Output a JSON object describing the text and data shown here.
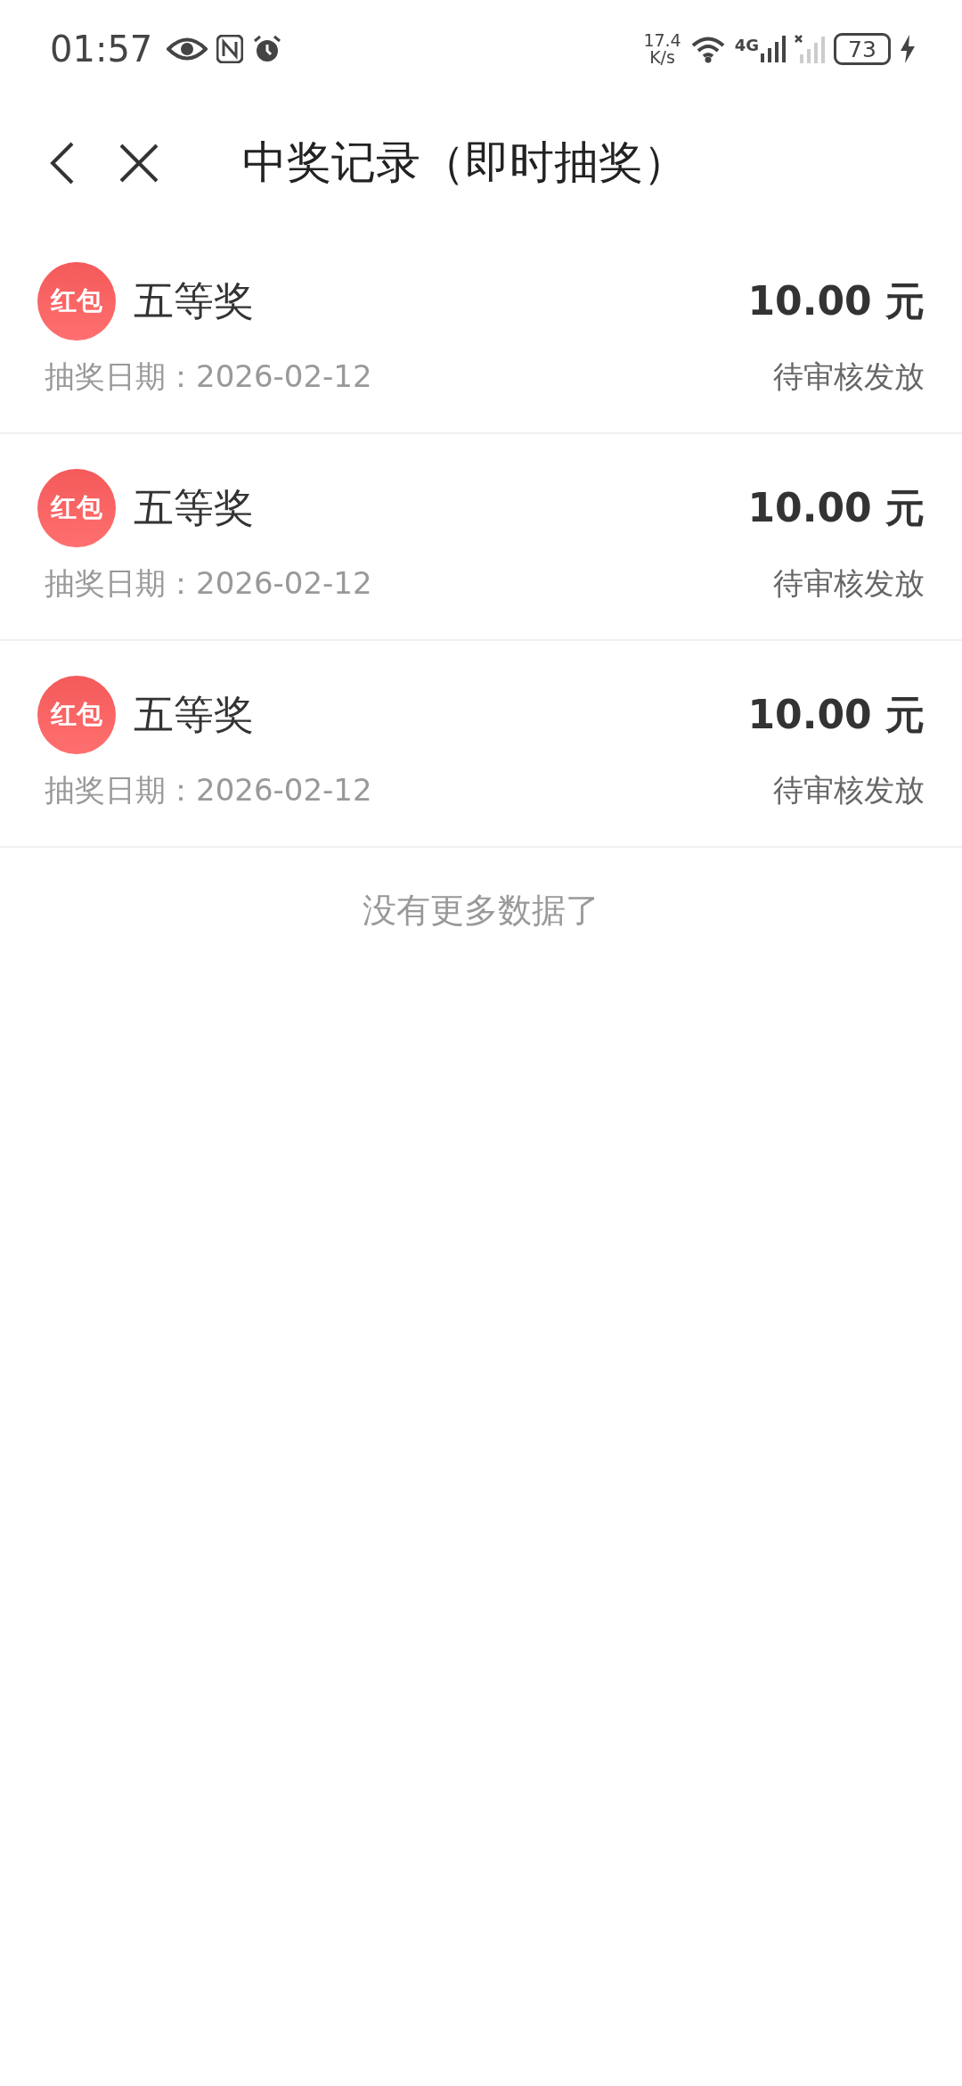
{
  "status_bar": {
    "time": "01:57",
    "net_speed_value": "17.4",
    "net_speed_unit": "K/s",
    "network": "4G",
    "battery": "73"
  },
  "header": {
    "title": "中奖记录（即时抽奖）"
  },
  "records": [
    {
      "badge": "红包",
      "prize": "五等奖",
      "amount": "10.00 元",
      "date_label": "抽奖日期：",
      "date": "2026-02-12",
      "status": "待审核发放"
    },
    {
      "badge": "红包",
      "prize": "五等奖",
      "amount": "10.00 元",
      "date_label": "抽奖日期：",
      "date": "2026-02-12",
      "status": "待审核发放"
    },
    {
      "badge": "红包",
      "prize": "五等奖",
      "amount": "10.00 元",
      "date_label": "抽奖日期：",
      "date": "2026-02-12",
      "status": "待审核发放"
    }
  ],
  "footer": "没有更多数据了"
}
